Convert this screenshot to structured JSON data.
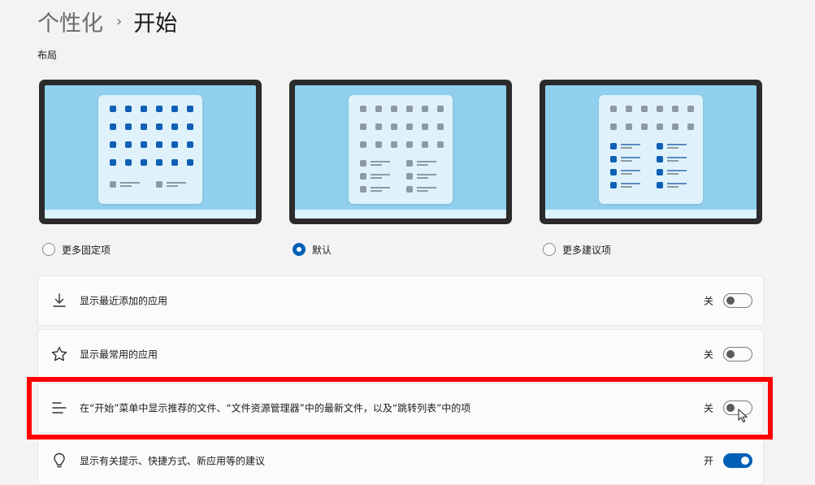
{
  "breadcrumb": {
    "parent": "个性化",
    "separator": "›",
    "current": "开始"
  },
  "layout_section": {
    "label": "布局",
    "options": [
      {
        "label": "更多固定项",
        "selected": false
      },
      {
        "label": "默认",
        "selected": true
      },
      {
        "label": "更多建议项",
        "selected": false
      }
    ]
  },
  "settings": [
    {
      "label": "显示最近添加的应用",
      "icon": "download-icon",
      "state": "关",
      "on": false
    },
    {
      "label": "显示最常用的应用",
      "icon": "star-icon",
      "state": "关",
      "on": false
    },
    {
      "label": "在“开始”菜单中显示推荐的文件、“文件资源管理器”中的最新文件，以及“跳转列表”中的项",
      "icon": "list-icon",
      "state": "关",
      "on": false
    },
    {
      "label": "显示有关提示、快捷方式、新应用等的建议",
      "icon": "lightbulb-icon",
      "state": "开",
      "on": true
    }
  ],
  "colors": {
    "accent": "#005fb8",
    "highlight": "#ff0000",
    "preview_wallpaper": "#90d0ee"
  }
}
